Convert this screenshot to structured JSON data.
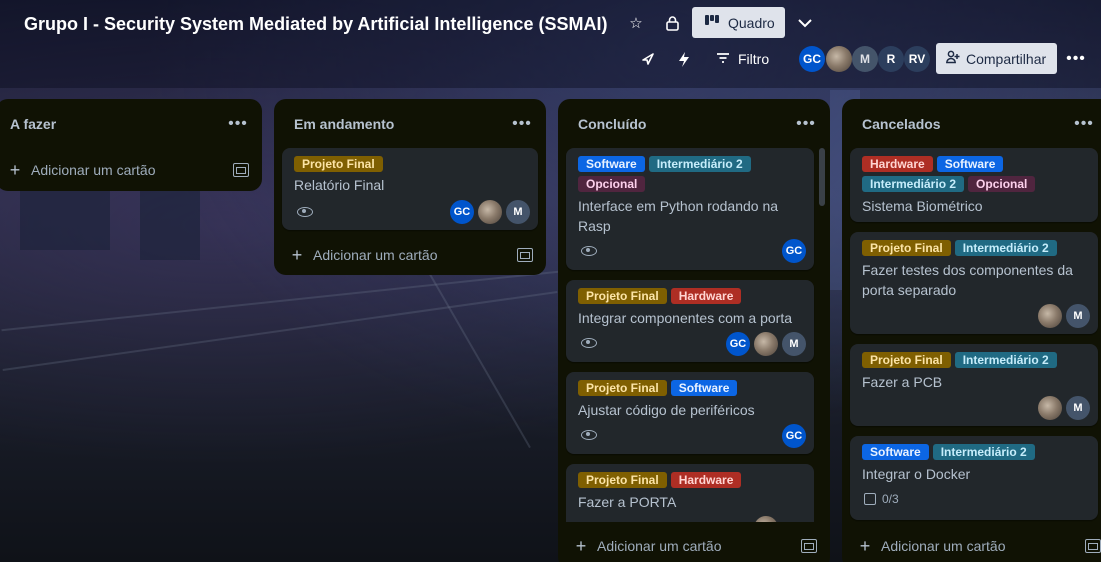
{
  "board": {
    "title": "Grupo I - Security System Mediated by Artificial Intelligence (SSMAI)",
    "view_label": "Quadro",
    "filter_label": "Filtro",
    "share_label": "Compartilhar"
  },
  "members": [
    {
      "initials": "GC",
      "color": "#0055cc"
    },
    {
      "initials": "",
      "color": "photo"
    },
    {
      "initials": "M",
      "color": "#44546a"
    },
    {
      "initials": "R",
      "color": "#2c3e5d"
    },
    {
      "initials": "RV",
      "color": "#2c3e5d"
    }
  ],
  "add_card_label": "Adicionar um cartão",
  "lists": [
    {
      "title": "A fazer",
      "cards": []
    },
    {
      "title": "Em andamento",
      "cards": [
        {
          "labels": [
            "Projeto Final"
          ],
          "title": "Relatório Final",
          "members": [
            "GC",
            "photo",
            "M"
          ]
        }
      ]
    },
    {
      "title": "Concluído",
      "cards": [
        {
          "labels": [
            "Software",
            "Intermediário 2",
            "Opcional"
          ],
          "title": "Interface em Python rodando na Rasp",
          "members": [
            "GC"
          ]
        },
        {
          "labels": [
            "Projeto Final",
            "Hardware"
          ],
          "title": "Integrar componentes com a porta",
          "members": [
            "GC",
            "photo",
            "M"
          ]
        },
        {
          "labels": [
            "Projeto Final",
            "Software"
          ],
          "title": "Ajustar código de periféricos",
          "members": [
            "GC"
          ]
        },
        {
          "labels": [
            "Projeto Final",
            "Hardware"
          ],
          "title": "Fazer a PORTA",
          "members": [
            "photo"
          ]
        }
      ]
    },
    {
      "title": "Cancelados",
      "cards": [
        {
          "labels": [
            "Hardware",
            "Software",
            "Intermediário 2",
            "Opcional"
          ],
          "title": "Sistema Biométrico",
          "members": []
        },
        {
          "labels": [
            "Projeto Final",
            "Intermediário 2"
          ],
          "title": "Fazer testes dos componentes da porta separado",
          "members": [
            "photo",
            "M"
          ]
        },
        {
          "labels": [
            "Projeto Final",
            "Intermediário 2"
          ],
          "title": "Fazer a PCB",
          "members": [
            "photo",
            "M"
          ]
        },
        {
          "labels": [
            "Software",
            "Intermediário 2"
          ],
          "title": "Integrar o Docker",
          "checklist": "0/3",
          "members": []
        }
      ]
    }
  ],
  "colors": {
    "list_bg": "#101204",
    "card_bg": "#22272b",
    "label_projeto": "#7f5f01",
    "label_hardware": "#ae2e24",
    "label_software": "#0c66e4",
    "label_intermediario": "#206a83",
    "label_opcional": "#50253f"
  },
  "icons": [
    "star-icon",
    "lock-icon",
    "board-view-icon",
    "chevron-down-icon",
    "rocket-icon",
    "lightning-icon",
    "filter-icon",
    "add-person-icon",
    "more-icon",
    "eye-icon",
    "checklist-icon",
    "plus-icon",
    "template-icon"
  ]
}
